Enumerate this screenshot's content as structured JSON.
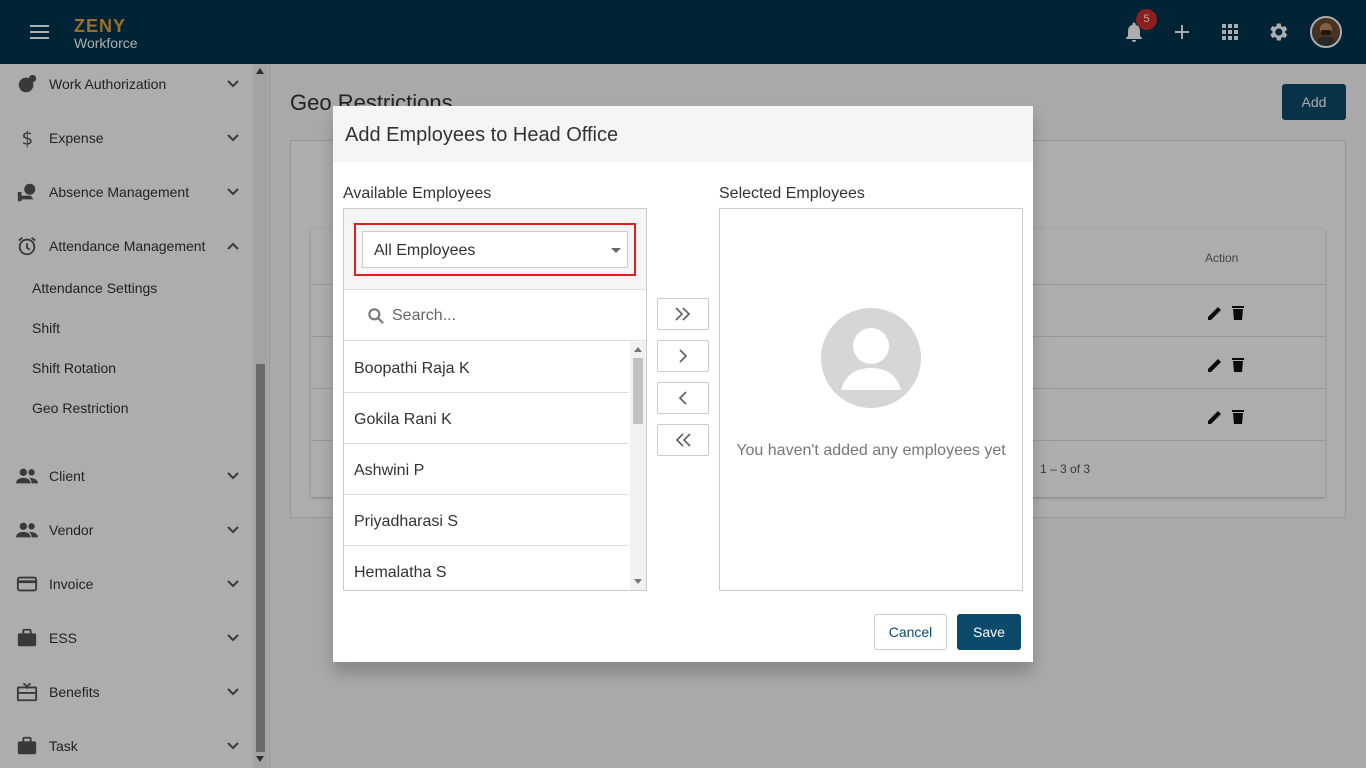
{
  "header": {
    "logo_top": "ZENY",
    "logo_bottom": "Workforce",
    "notification_count": "5",
    "icons": [
      "menu-icon",
      "bell-icon",
      "plus-icon",
      "apps-grid-icon",
      "gear-icon",
      "avatar"
    ]
  },
  "sidebar": {
    "items": [
      {
        "label": "Work Authorization",
        "icon": "globe-icon",
        "expanded": false
      },
      {
        "label": "Expense",
        "icon": "dollar-icon",
        "expanded": false
      },
      {
        "label": "Absence Management",
        "icon": "absence-icon",
        "expanded": false
      },
      {
        "label": "Attendance Management",
        "icon": "alarm-icon",
        "expanded": true
      },
      {
        "label": "Client",
        "icon": "people-icon",
        "expanded": false
      },
      {
        "label": "Vendor",
        "icon": "people-icon",
        "expanded": false
      },
      {
        "label": "Invoice",
        "icon": "card-icon",
        "expanded": false
      },
      {
        "label": "ESS",
        "icon": "briefcase-icon",
        "expanded": false
      },
      {
        "label": "Benefits",
        "icon": "gift-icon",
        "expanded": false
      },
      {
        "label": "Task",
        "icon": "briefcase-icon",
        "expanded": false
      }
    ],
    "sub_items": [
      "Attendance Settings",
      "Shift",
      "Shift Rotation",
      "Geo Restriction"
    ]
  },
  "page": {
    "title": "Geo Restrictions",
    "add_button": "Add",
    "table_action_header": "Action",
    "paginator_range": "1 – 3 of 3"
  },
  "dialog": {
    "title": "Add Employees to Head Office",
    "available_label": "Available Employees",
    "selected_label": "Selected Employees",
    "filter_value": "All Employees",
    "search_placeholder": "Search...",
    "employees": [
      "Boopathi Raja K",
      "Gokila Rani K",
      "Ashwini P",
      "Priyadharasi S",
      "Hemalatha S"
    ],
    "empty_message": "You haven't added any employees yet",
    "cancel_label": "Cancel",
    "save_label": "Save"
  },
  "colors": {
    "topbar": "#00364f",
    "primary": "#0b4a6b",
    "highlight": "#e01e1e",
    "badge": "#d32f2f"
  }
}
